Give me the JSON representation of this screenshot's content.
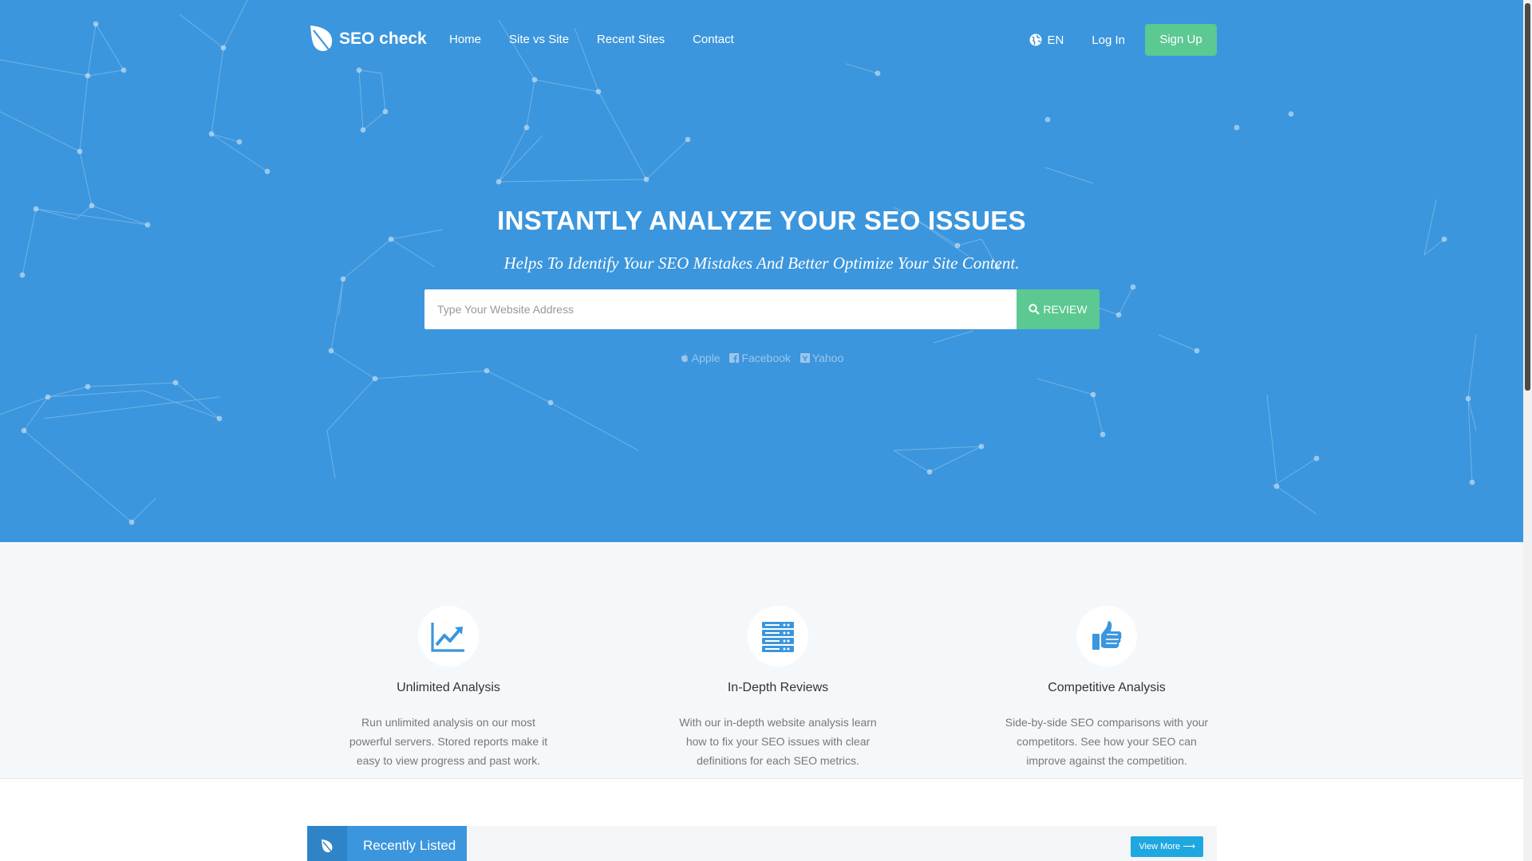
{
  "brand": {
    "name": "SEO check",
    "icon": "leaf-icon"
  },
  "nav": {
    "items": [
      {
        "label": "Home"
      },
      {
        "label": "Site vs Site"
      },
      {
        "label": "Recent Sites"
      },
      {
        "label": "Contact"
      }
    ],
    "language": "EN",
    "login": "Log In",
    "signup": "Sign Up"
  },
  "hero": {
    "title": "INSTANTLY ANALYZE YOUR SEO ISSUES",
    "subtitle": "Helps To Identify Your SEO Mistakes And Better Optimize Your Site Content.",
    "search_placeholder": "Type Your Website Address",
    "search_value": "",
    "review_label": "REVIEW",
    "examples": [
      {
        "label": "Apple",
        "icon": "apple-icon"
      },
      {
        "label": "Facebook",
        "icon": "facebook-icon"
      },
      {
        "label": "Yahoo",
        "icon": "yahoo-icon"
      }
    ]
  },
  "features": [
    {
      "icon": "line-chart-icon",
      "title": "Unlimited Analysis",
      "text": "Run unlimited analysis on our most powerful servers. Stored reports make it easy to view progress and past work."
    },
    {
      "icon": "server-icon",
      "title": "In-Depth Reviews",
      "text": "With our in-depth website analysis learn how to fix your SEO issues with clear definitions for each SEO metrics."
    },
    {
      "icon": "thumbs-up-icon",
      "title": "Competitive Analysis",
      "text": "Side-by-side SEO comparisons with your competitors. See how your SEO can improve against the competition."
    }
  ],
  "recent": {
    "title": "Recently Listed",
    "view_more": "View More ⟶"
  },
  "colors": {
    "hero_bg": "#3b96dd",
    "accent_green": "#5cc892",
    "icon_blue": "#3b96dd",
    "view_more_bg": "#1fa8e0"
  }
}
